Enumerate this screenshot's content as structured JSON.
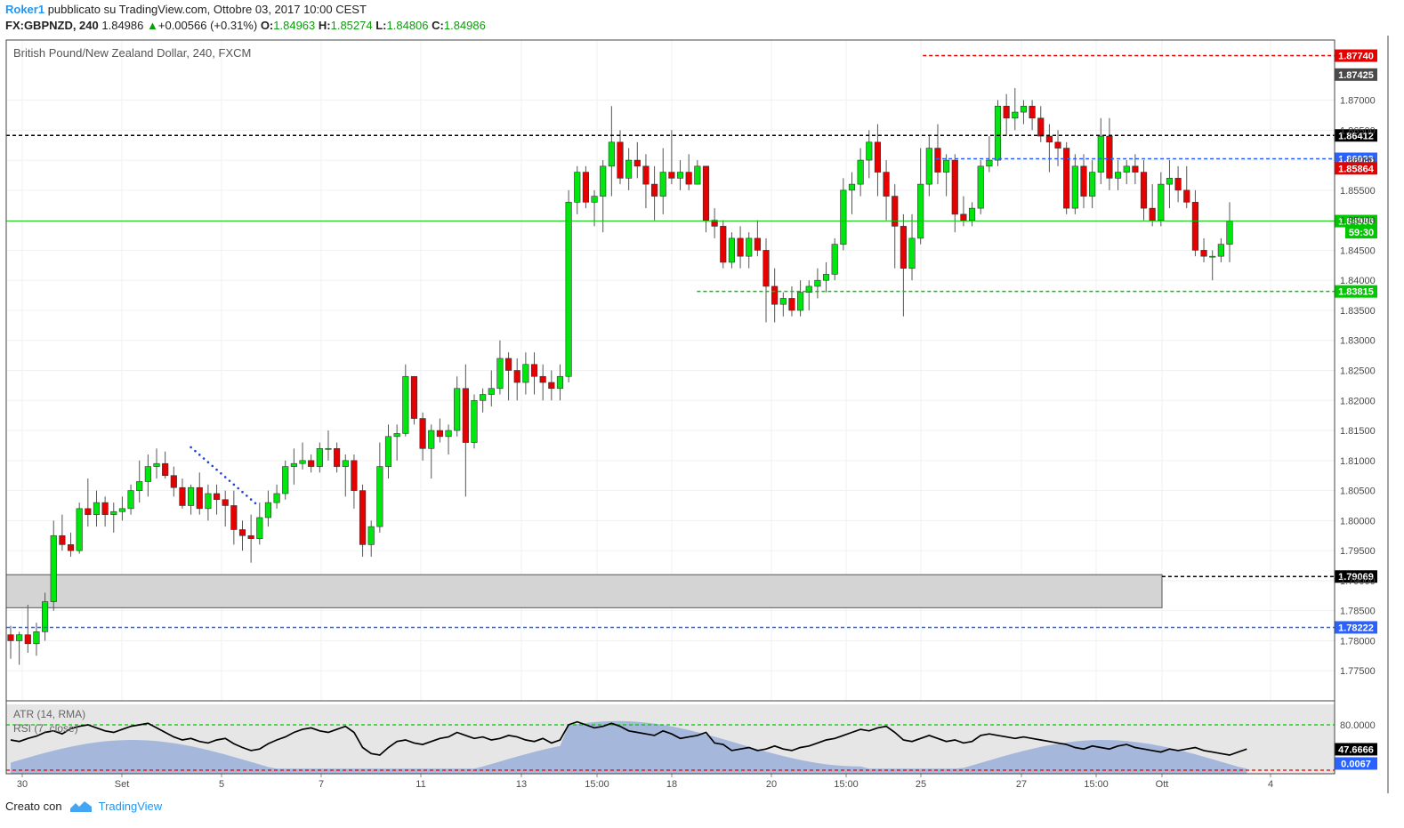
{
  "header": {
    "author": "Roker1",
    "published_text": " pubblicato su TradingView.com, Ottobre 03, 2017 10:00 CEST",
    "symbol": "FX:GBPNZD, 240",
    "last": "1.84986",
    "change": "+0.00566 (+0.31%)",
    "open_label": "O:",
    "open": "1.84963",
    "high_label": "H:",
    "high": "1.85274",
    "low_label": "L:",
    "low": "1.84806",
    "close_label": "C:",
    "close": "1.84986"
  },
  "chart_title": "British Pound/New Zealand Dollar, 240, FXCM",
  "indicators": {
    "atr_label": "ATR (14, RMA)",
    "rsi_label": "RSI (7, close)",
    "rsi_value": "47.6666",
    "atr_value": "0.0067"
  },
  "footer": {
    "created_with": "Creato con",
    "brand": "TradingView"
  },
  "colors": {
    "up": "#00e60f",
    "down": "#e60000",
    "resistance": "#e60000",
    "support": "#00c800",
    "blue_level": "#2962ff",
    "black_level": "#000000",
    "rsi_line": "#000000",
    "atr_area": "#8fa8d8"
  },
  "chart_data": {
    "type": "candlestick",
    "title": "British Pound/New Zealand Dollar, 240, FXCM",
    "ylim": [
      1.77,
      1.88
    ],
    "y_ticks": [
      "1.87000",
      "1.86500",
      "1.86000",
      "1.85500",
      "1.85000",
      "1.84500",
      "1.84000",
      "1.83500",
      "1.83000",
      "1.82500",
      "1.82000",
      "1.81500",
      "1.81000",
      "1.80500",
      "1.80000",
      "1.79500",
      "1.79000",
      "1.78500",
      "1.78000",
      "1.77500"
    ],
    "x_ticks": [
      "30",
      "Set",
      "5",
      "7",
      "11",
      "13",
      "15:00",
      "18",
      "20",
      "15:00",
      "25",
      "27",
      "15:00",
      "Ott",
      "4"
    ],
    "candles": [
      [
        1.781,
        1.7825,
        1.777,
        1.78
      ],
      [
        1.78,
        1.7815,
        1.776,
        1.781
      ],
      [
        1.781,
        1.786,
        1.778,
        1.7795
      ],
      [
        1.7795,
        1.783,
        1.7775,
        1.7815
      ],
      [
        1.7815,
        1.788,
        1.78,
        1.7865
      ],
      [
        1.7865,
        1.8,
        1.785,
        1.7975
      ],
      [
        1.7975,
        1.801,
        1.795,
        1.796
      ],
      [
        1.796,
        1.798,
        1.794,
        1.795
      ],
      [
        1.795,
        1.803,
        1.7945,
        1.802
      ],
      [
        1.802,
        1.807,
        1.799,
        1.801
      ],
      [
        1.801,
        1.805,
        1.799,
        1.803
      ],
      [
        1.803,
        1.804,
        1.799,
        1.801
      ],
      [
        1.801,
        1.803,
        1.798,
        1.8015
      ],
      [
        1.8015,
        1.804,
        1.8,
        1.802
      ],
      [
        1.802,
        1.806,
        1.801,
        1.805
      ],
      [
        1.805,
        1.81,
        1.803,
        1.8065
      ],
      [
        1.8065,
        1.811,
        1.804,
        1.809
      ],
      [
        1.809,
        1.812,
        1.807,
        1.8095
      ],
      [
        1.8095,
        1.8115,
        1.807,
        1.8075
      ],
      [
        1.8075,
        1.809,
        1.804,
        1.8055
      ],
      [
        1.8055,
        1.807,
        1.802,
        1.8025
      ],
      [
        1.8025,
        1.806,
        1.801,
        1.8055
      ],
      [
        1.8055,
        1.808,
        1.801,
        1.802
      ],
      [
        1.802,
        1.806,
        1.8,
        1.8045
      ],
      [
        1.8045,
        1.806,
        1.801,
        1.8035
      ],
      [
        1.8035,
        1.805,
        1.799,
        1.8025
      ],
      [
        1.8025,
        1.805,
        1.796,
        1.7985
      ],
      [
        1.7985,
        1.8,
        1.795,
        1.7975
      ],
      [
        1.7975,
        1.801,
        1.793,
        1.797
      ],
      [
        1.797,
        1.803,
        1.796,
        1.8005
      ],
      [
        1.8005,
        1.805,
        1.799,
        1.803
      ],
      [
        1.803,
        1.806,
        1.802,
        1.8045
      ],
      [
        1.8045,
        1.81,
        1.8035,
        1.809
      ],
      [
        1.809,
        1.812,
        1.806,
        1.8095
      ],
      [
        1.8095,
        1.813,
        1.8085,
        1.81
      ],
      [
        1.81,
        1.811,
        1.808,
        1.809
      ],
      [
        1.809,
        1.813,
        1.808,
        1.812
      ],
      [
        1.812,
        1.815,
        1.81,
        1.812
      ],
      [
        1.812,
        1.813,
        1.808,
        1.809
      ],
      [
        1.809,
        1.811,
        1.804,
        1.81
      ],
      [
        1.81,
        1.811,
        1.802,
        1.805
      ],
      [
        1.805,
        1.806,
        1.794,
        1.796
      ],
      [
        1.796,
        1.8,
        1.794,
        1.799
      ],
      [
        1.799,
        1.813,
        1.798,
        1.809
      ],
      [
        1.809,
        1.816,
        1.807,
        1.814
      ],
      [
        1.814,
        1.816,
        1.81,
        1.8145
      ],
      [
        1.8145,
        1.826,
        1.814,
        1.824
      ],
      [
        1.824,
        1.824,
        1.816,
        1.817
      ],
      [
        1.817,
        1.818,
        1.81,
        1.812
      ],
      [
        1.812,
        1.816,
        1.807,
        1.815
      ],
      [
        1.815,
        1.817,
        1.813,
        1.814
      ],
      [
        1.814,
        1.816,
        1.811,
        1.815
      ],
      [
        1.815,
        1.824,
        1.814,
        1.822
      ],
      [
        1.822,
        1.826,
        1.804,
        1.813
      ],
      [
        1.813,
        1.821,
        1.812,
        1.82
      ],
      [
        1.82,
        1.822,
        1.818,
        1.821
      ],
      [
        1.821,
        1.825,
        1.819,
        1.822
      ],
      [
        1.822,
        1.83,
        1.821,
        1.827
      ],
      [
        1.827,
        1.828,
        1.82,
        1.825
      ],
      [
        1.825,
        1.827,
        1.82,
        1.823
      ],
      [
        1.823,
        1.828,
        1.821,
        1.826
      ],
      [
        1.826,
        1.828,
        1.821,
        1.824
      ],
      [
        1.824,
        1.826,
        1.82,
        1.823
      ],
      [
        1.823,
        1.825,
        1.82,
        1.822
      ],
      [
        1.822,
        1.826,
        1.82,
        1.824
      ],
      [
        1.824,
        1.855,
        1.823,
        1.853
      ],
      [
        1.853,
        1.859,
        1.851,
        1.858
      ],
      [
        1.858,
        1.859,
        1.852,
        1.853
      ],
      [
        1.853,
        1.855,
        1.849,
        1.854
      ],
      [
        1.854,
        1.86,
        1.848,
        1.859
      ],
      [
        1.859,
        1.869,
        1.854,
        1.863
      ],
      [
        1.863,
        1.865,
        1.856,
        1.857
      ],
      [
        1.857,
        1.862,
        1.855,
        1.86
      ],
      [
        1.86,
        1.863,
        1.857,
        1.859
      ],
      [
        1.859,
        1.861,
        1.852,
        1.856
      ],
      [
        1.856,
        1.859,
        1.85,
        1.854
      ],
      [
        1.854,
        1.862,
        1.851,
        1.858
      ],
      [
        1.858,
        1.865,
        1.856,
        1.857
      ],
      [
        1.857,
        1.86,
        1.855,
        1.858
      ],
      [
        1.858,
        1.861,
        1.855,
        1.856
      ],
      [
        1.856,
        1.86,
        1.856,
        1.859
      ],
      [
        1.859,
        1.859,
        1.848,
        1.85
      ],
      [
        1.85,
        1.852,
        1.847,
        1.849
      ],
      [
        1.849,
        1.85,
        1.842,
        1.843
      ],
      [
        1.843,
        1.848,
        1.842,
        1.847
      ],
      [
        1.847,
        1.849,
        1.842,
        1.844
      ],
      [
        1.844,
        1.848,
        1.842,
        1.847
      ],
      [
        1.847,
        1.85,
        1.844,
        1.845
      ],
      [
        1.845,
        1.847,
        1.833,
        1.839
      ],
      [
        1.839,
        1.842,
        1.833,
        1.836
      ],
      [
        1.836,
        1.838,
        1.834,
        1.837
      ],
      [
        1.837,
        1.839,
        1.834,
        1.835
      ],
      [
        1.835,
        1.84,
        1.834,
        1.838
      ],
      [
        1.838,
        1.84,
        1.835,
        1.839
      ],
      [
        1.839,
        1.842,
        1.837,
        1.84
      ],
      [
        1.84,
        1.843,
        1.838,
        1.841
      ],
      [
        1.841,
        1.847,
        1.84,
        1.846
      ],
      [
        1.846,
        1.857,
        1.845,
        1.855
      ],
      [
        1.855,
        1.858,
        1.851,
        1.856
      ],
      [
        1.856,
        1.862,
        1.854,
        1.86
      ],
      [
        1.86,
        1.865,
        1.857,
        1.863
      ],
      [
        1.863,
        1.866,
        1.854,
        1.858
      ],
      [
        1.858,
        1.86,
        1.85,
        1.854
      ],
      [
        1.854,
        1.856,
        1.842,
        1.849
      ],
      [
        1.849,
        1.851,
        1.834,
        1.842
      ],
      [
        1.842,
        1.851,
        1.84,
        1.847
      ],
      [
        1.847,
        1.862,
        1.846,
        1.856
      ],
      [
        1.856,
        1.864,
        1.854,
        1.862
      ],
      [
        1.862,
        1.866,
        1.856,
        1.858
      ],
      [
        1.858,
        1.861,
        1.854,
        1.86
      ],
      [
        1.86,
        1.861,
        1.848,
        1.851
      ],
      [
        1.851,
        1.854,
        1.849,
        1.85
      ],
      [
        1.85,
        1.853,
        1.849,
        1.852
      ],
      [
        1.852,
        1.86,
        1.851,
        1.859
      ],
      [
        1.859,
        1.864,
        1.858,
        1.86
      ],
      [
        1.86,
        1.87,
        1.859,
        1.869
      ],
      [
        1.869,
        1.871,
        1.864,
        1.867
      ],
      [
        1.867,
        1.872,
        1.865,
        1.868
      ],
      [
        1.868,
        1.87,
        1.866,
        1.869
      ],
      [
        1.869,
        1.87,
        1.865,
        1.867
      ],
      [
        1.867,
        1.869,
        1.863,
        1.864
      ],
      [
        1.864,
        1.866,
        1.858,
        1.863
      ],
      [
        1.863,
        1.865,
        1.859,
        1.862
      ],
      [
        1.862,
        1.863,
        1.851,
        1.852
      ],
      [
        1.852,
        1.861,
        1.851,
        1.859
      ],
      [
        1.859,
        1.861,
        1.852,
        1.854
      ],
      [
        1.854,
        1.86,
        1.852,
        1.858
      ],
      [
        1.858,
        1.867,
        1.856,
        1.864
      ],
      [
        1.864,
        1.867,
        1.855,
        1.857
      ],
      [
        1.857,
        1.86,
        1.855,
        1.858
      ],
      [
        1.858,
        1.86,
        1.856,
        1.859
      ],
      [
        1.859,
        1.861,
        1.856,
        1.858
      ],
      [
        1.858,
        1.86,
        1.85,
        1.852
      ],
      [
        1.852,
        1.856,
        1.849,
        1.85
      ],
      [
        1.85,
        1.858,
        1.849,
        1.856
      ],
      [
        1.856,
        1.86,
        1.852,
        1.857
      ],
      [
        1.857,
        1.859,
        1.853,
        1.855
      ],
      [
        1.855,
        1.859,
        1.852,
        1.853
      ],
      [
        1.853,
        1.855,
        1.844,
        1.845
      ],
      [
        1.845,
        1.847,
        1.843,
        1.844
      ],
      [
        1.844,
        1.845,
        1.84,
        1.844
      ],
      [
        1.844,
        1.847,
        1.843,
        1.846
      ],
      [
        1.846,
        1.853,
        1.843,
        1.8499
      ]
    ],
    "levels": [
      {
        "label": "1.87740",
        "value": 1.8774,
        "color": "#e60000",
        "style": "dashed",
        "from": 0.69
      },
      {
        "label": "1.87425",
        "value": 1.87425,
        "color": "#4a4a4a",
        "style": "none",
        "from": 1.0
      },
      {
        "label": "1.86412",
        "value": 1.86412,
        "color": "#000000",
        "style": "dashed",
        "from": 0.0
      },
      {
        "label": "1.86023",
        "value": 1.86023,
        "color": "#2962ff",
        "style": "dashed",
        "from": 0.7
      },
      {
        "label": "1.85864",
        "value": 1.85864,
        "color": "#e60000",
        "style": "none",
        "from": 1.0
      },
      {
        "label": "1.84986",
        "value": 1.84986,
        "color": "#00c800",
        "style": "solid",
        "from": 0.0
      },
      {
        "label": "59:30",
        "value": 1.848,
        "color": "#00c800",
        "style": "none",
        "from": 1.0
      },
      {
        "label": "1.83815",
        "value": 1.83815,
        "color": "#00c800",
        "style": "dashed",
        "from": 0.52
      },
      {
        "label": "1.79069",
        "value": 1.79069,
        "color": "#000000",
        "style": "dashed",
        "from": 0.87
      },
      {
        "label": "1.78222",
        "value": 1.78222,
        "color": "#2962ff",
        "style": "dashed",
        "from": 0.0
      }
    ],
    "zone": {
      "top": 1.791,
      "bottom": 1.7855
    },
    "rsi": [
      60,
      58,
      62,
      65,
      70,
      72,
      68,
      75,
      78,
      80,
      76,
      72,
      70,
      74,
      78,
      80,
      82,
      76,
      70,
      64,
      60,
      62,
      58,
      56,
      60,
      62,
      55,
      50,
      46,
      48,
      55,
      60,
      64,
      70,
      74,
      76,
      72,
      70,
      74,
      78,
      70,
      50,
      42,
      40,
      50,
      58,
      60,
      56,
      54,
      58,
      62,
      64,
      70,
      66,
      62,
      64,
      60,
      62,
      66,
      64,
      60,
      58,
      62,
      56,
      60,
      80,
      84,
      80,
      76,
      78,
      82,
      78,
      72,
      70,
      68,
      66,
      72,
      68,
      62,
      64,
      66,
      70,
      56,
      54,
      46,
      48,
      50,
      46,
      48,
      52,
      48,
      46,
      50,
      52,
      56,
      60,
      62,
      66,
      70,
      74,
      72,
      76,
      78,
      70,
      60,
      58,
      62,
      66,
      62,
      58,
      60,
      56,
      58,
      66,
      68,
      66,
      64,
      62,
      64,
      62,
      60,
      58,
      56,
      54,
      50,
      48,
      52,
      50,
      48,
      52,
      54,
      50,
      48,
      46,
      44,
      48,
      46,
      48,
      50,
      46,
      44,
      42,
      40,
      44,
      48
    ]
  }
}
